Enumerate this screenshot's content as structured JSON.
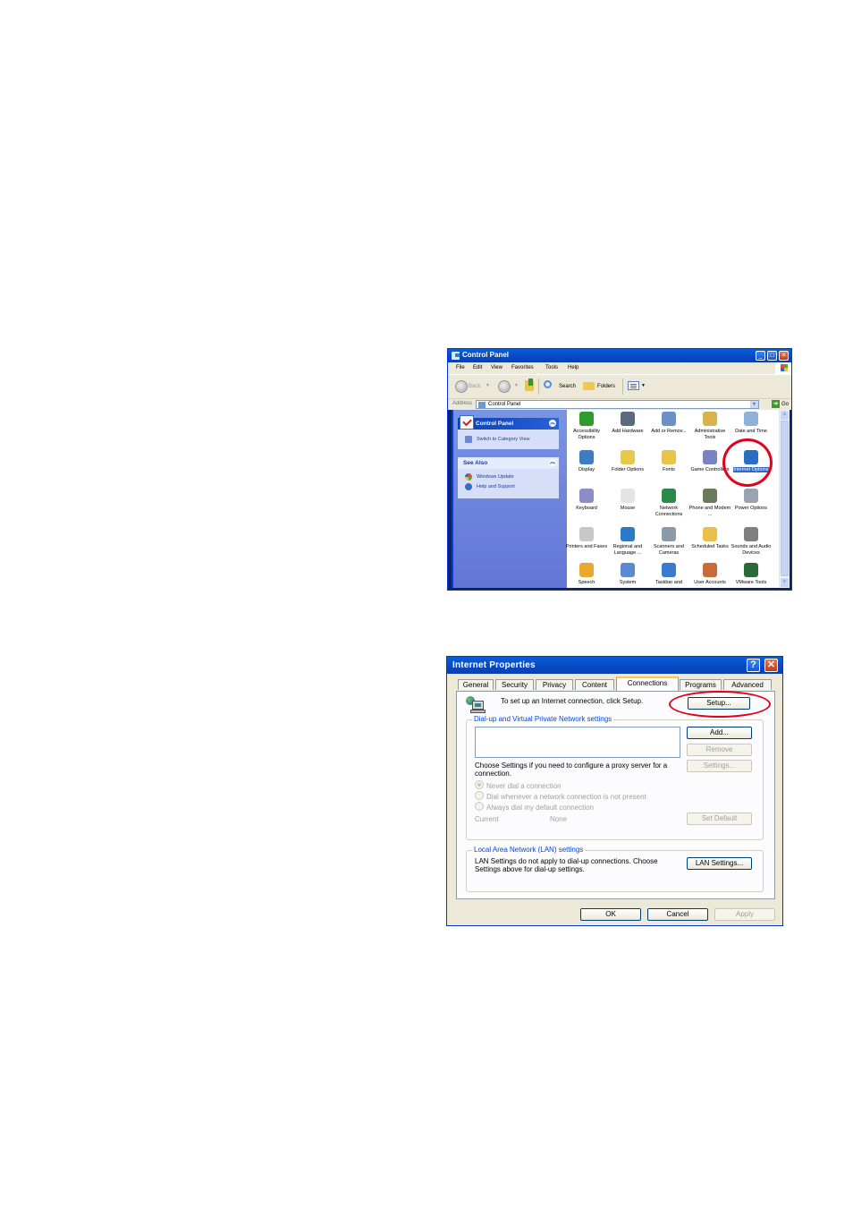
{
  "control_panel": {
    "title": "Control Panel",
    "menu": [
      "File",
      "Edit",
      "View",
      "Favorites",
      "Tools",
      "Help"
    ],
    "toolbar": {
      "back_label": "Back",
      "search_label": "Search",
      "folders_label": "Folders"
    },
    "address": {
      "label": "Address",
      "value": "Control Panel",
      "go_label": "Go"
    },
    "task_panels": [
      {
        "title": "Control Panel",
        "links": [
          "Switch to Category View"
        ]
      },
      {
        "title": "See Also",
        "links": [
          "Windows Update",
          "Help and Support"
        ]
      }
    ],
    "items": [
      {
        "label": "Accessibility Options",
        "icon": "accessibility-icon",
        "color": "#2f9a2f"
      },
      {
        "label": "Add Hardware",
        "icon": "add-hardware-icon",
        "color": "#5a6b7d"
      },
      {
        "label": "Add or Remov...",
        "icon": "add-remove-programs-icon",
        "color": "#6b8fc7"
      },
      {
        "label": "Administrative Tools",
        "icon": "administrative-tools-icon",
        "color": "#d8b24a"
      },
      {
        "label": "Date and Time",
        "icon": "date-time-icon",
        "color": "#8fb0d8"
      },
      {
        "label": "Display",
        "icon": "display-icon",
        "color": "#3c7cc4"
      },
      {
        "label": "Folder Options",
        "icon": "folder-options-icon",
        "color": "#e6c84e"
      },
      {
        "label": "Fonts",
        "icon": "fonts-icon",
        "color": "#e8c44a"
      },
      {
        "label": "Game Controllers",
        "icon": "game-controllers-icon",
        "color": "#7a82c4"
      },
      {
        "label": "Internet Options",
        "icon": "internet-options-icon",
        "color": "#2a6dc4",
        "selected": true
      },
      {
        "label": "Keyboard",
        "icon": "keyboard-icon",
        "color": "#8a8fc8"
      },
      {
        "label": "Mouse",
        "icon": "mouse-icon",
        "color": "#e4e4e4"
      },
      {
        "label": "Network Connections",
        "icon": "network-connections-icon",
        "color": "#2b8a4a"
      },
      {
        "label": "Phone and Modem ...",
        "icon": "phone-modem-icon",
        "color": "#6a7a5a"
      },
      {
        "label": "Power Options",
        "icon": "power-options-icon",
        "color": "#9aa4b0"
      },
      {
        "label": "Printers and Faxes",
        "icon": "printers-faxes-icon",
        "color": "#c8c8c8"
      },
      {
        "label": "Regional and Language ...",
        "icon": "regional-language-icon",
        "color": "#2a7ac8"
      },
      {
        "label": "Scanners and Cameras",
        "icon": "scanners-cameras-icon",
        "color": "#8a9aaa"
      },
      {
        "label": "Scheduled Tasks",
        "icon": "scheduled-tasks-icon",
        "color": "#e8c04a"
      },
      {
        "label": "Sounds and Audio Devices",
        "icon": "sounds-audio-icon",
        "color": "#808080"
      },
      {
        "label": "Speech",
        "icon": "speech-icon",
        "color": "#e8a830"
      },
      {
        "label": "System",
        "icon": "system-icon",
        "color": "#5a8ad0"
      },
      {
        "label": "Taskbar and",
        "icon": "taskbar-icon",
        "color": "#3a7ad0"
      },
      {
        "label": "User Accounts",
        "icon": "user-accounts-icon",
        "color": "#c86a3a"
      },
      {
        "label": "VMware Tools",
        "icon": "vmware-tools-icon",
        "color": "#2a6a3a"
      }
    ]
  },
  "internet_properties": {
    "title": "Internet Properties",
    "help_button": "?",
    "close_button": "✕",
    "tabs": [
      "General",
      "Security",
      "Privacy",
      "Content",
      "Connections",
      "Programs",
      "Advanced"
    ],
    "active_tab": "Connections",
    "setup_text": "To set up an Internet connection, click Setup.",
    "setup_button": "Setup...",
    "dialup_group": {
      "legend": "Dial-up and Virtual Private Network settings",
      "add_button": "Add...",
      "remove_button": "Remove",
      "settings_button": "Settings...",
      "proxy_text": "Choose Settings if you need to configure a proxy server for a connection.",
      "radios": [
        {
          "label": "Never dial a connection",
          "checked": true
        },
        {
          "label": "Dial whenever a network connection is not present",
          "checked": false
        },
        {
          "label": "Always dial my default connection",
          "checked": false
        }
      ],
      "current_label": "Current",
      "current_value": "None",
      "set_default_button": "Set Default"
    },
    "lan_group": {
      "legend": "Local Area Network (LAN) settings",
      "text": "LAN Settings do not apply to dial-up connections. Choose Settings above for dial-up settings.",
      "lan_settings_button": "LAN Settings..."
    },
    "ok_button": "OK",
    "cancel_button": "Cancel",
    "apply_button": "Apply"
  },
  "annotations": {
    "highlight_color": "#e3001b"
  }
}
